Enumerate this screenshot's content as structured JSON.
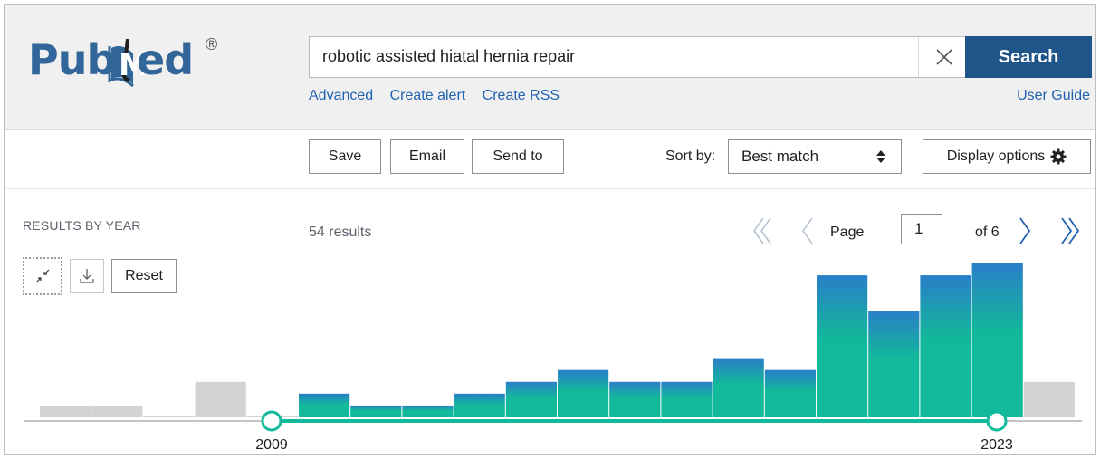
{
  "header": {
    "logo_pub": "Pub",
    "logo_ed": "ed",
    "logo_reg": "®",
    "search_value": "robotic assisted hiatal hernia repair",
    "search_button": "Search",
    "links": {
      "advanced": "Advanced",
      "create_alert": "Create alert",
      "create_rss": "Create RSS"
    },
    "user_guide": "User Guide"
  },
  "toolbar": {
    "save": "Save",
    "email": "Email",
    "send_to": "Send to",
    "sort_label": "Sort by:",
    "sort_value": "Best match",
    "display_options": "Display options"
  },
  "results": {
    "by_year_title": "RESULTS BY YEAR",
    "count": "54 results",
    "page_label": "Page",
    "page_value": "1",
    "of_pages": "of 6",
    "reset": "Reset"
  },
  "colors": {
    "brand_blue": "#20558a",
    "link_blue": "#2062b1",
    "bar_teal": "#12b99a",
    "bar_blue": "#2a7ec8",
    "bar_gray": "#d3d3d3"
  },
  "icons": {
    "clear": "close-icon",
    "sort": "sort-arrows-icon",
    "display": "gear-icon",
    "first": "double-chevron-left-icon",
    "prev": "chevron-left-icon",
    "next": "chevron-right-icon",
    "last": "double-chevron-right-icon",
    "collapse": "collapse-arrows-icon",
    "download": "download-icon"
  },
  "chart_data": {
    "type": "bar",
    "bar_values": [
      1,
      1,
      0,
      3,
      0,
      2,
      1,
      1,
      2,
      3,
      4,
      3,
      3,
      5,
      4,
      12,
      9,
      12,
      13,
      3
    ],
    "selected_range": [
      "2009",
      "2023"
    ],
    "x_tick_labels": [
      "2009",
      "2023"
    ]
  }
}
